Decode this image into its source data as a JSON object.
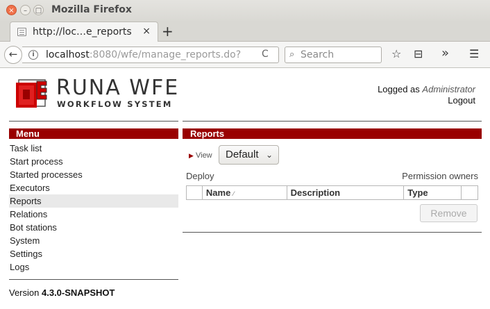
{
  "window": {
    "title": "Mozilla Firefox",
    "controls": {
      "close": "×",
      "minimize": "–",
      "maximize": "□"
    }
  },
  "tab": {
    "title": "http://loc…e_reports",
    "close": "×",
    "new_tab": "+"
  },
  "navbar": {
    "url_host": "localhost",
    "url_rest": ":8080/wfe/manage_reports.do?",
    "search_placeholder": "Search",
    "back": "←",
    "reload": "C",
    "info": "i",
    "search_icon": "⌕",
    "bookmark_star": "☆",
    "reading_list": "⊟",
    "overflow": "»",
    "menu": "☰"
  },
  "logo": {
    "title": "RUNA WFE",
    "subtitle": "WORKFLOW SYSTEM"
  },
  "user": {
    "logged_as": "Logged as",
    "name": "Administrator",
    "logout": "Logout"
  },
  "menu": {
    "header": "Menu",
    "items": [
      "Task list",
      "Start process",
      "Started processes",
      "Executors",
      "Reports",
      "Relations",
      "Bot stations",
      "System",
      "Settings",
      "Logs"
    ],
    "active": "Reports"
  },
  "version": {
    "label": "Version",
    "value": "4.3.0-SNAPSHOT"
  },
  "reports": {
    "header": "Reports",
    "view_label": "View",
    "view_arrow": "▶",
    "dropdown_value": "Default",
    "dropdown_chevron": "⌄",
    "deploy_link": "Deploy",
    "permission_link": "Permission owners",
    "columns": [
      "",
      "Name",
      "Description",
      "Type",
      ""
    ],
    "sort_marker": "⁄",
    "remove_button": "Remove"
  },
  "colors": {
    "accent": "#990000",
    "active_menu_bg": "#e9e9e9"
  }
}
